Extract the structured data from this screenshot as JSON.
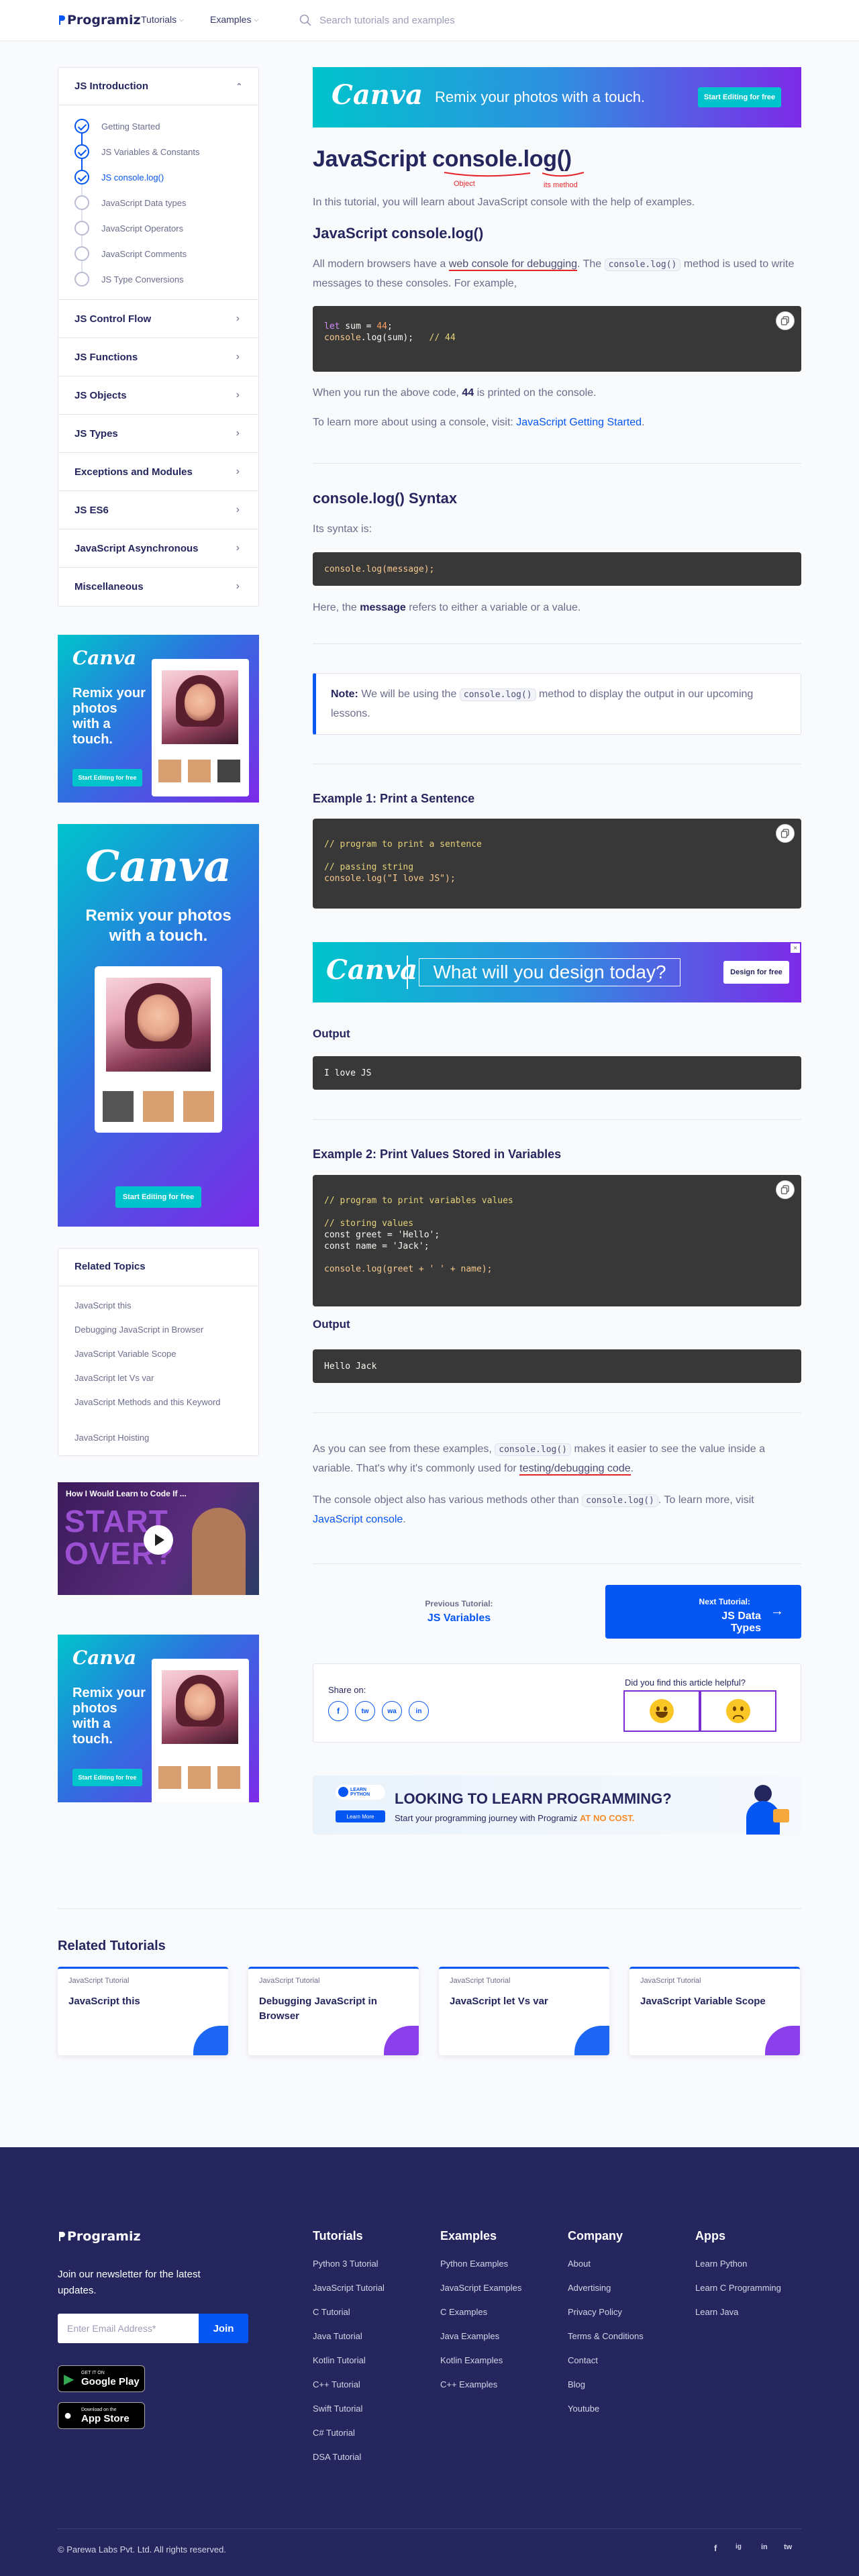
{
  "header": {
    "logo": "Programiz",
    "nav": [
      {
        "label": "Tutorials"
      },
      {
        "label": "Examples"
      }
    ],
    "search_placeholder": "Search tutorials and examples"
  },
  "sidebar": {
    "section_title": "JS Introduction",
    "lessons": [
      {
        "label": "Getting Started",
        "state": "done"
      },
      {
        "label": "JS Variables & Constants",
        "state": "done"
      },
      {
        "label": "JS console.log()",
        "state": "current"
      },
      {
        "label": "JavaScript Data types",
        "state": "todo"
      },
      {
        "label": "JavaScript Operators",
        "state": "todo"
      },
      {
        "label": "JavaScript Comments",
        "state": "todo"
      },
      {
        "label": "JS Type Conversions",
        "state": "todo"
      }
    ],
    "sections": [
      {
        "label": "JS Control Flow"
      },
      {
        "label": "JS Functions"
      },
      {
        "label": "JS Objects"
      },
      {
        "label": "JS Types"
      },
      {
        "label": "Exceptions and Modules"
      },
      {
        "label": "JS ES6"
      },
      {
        "label": "JavaScript Asynchronous"
      },
      {
        "label": "Miscellaneous"
      }
    ]
  },
  "ads": {
    "brand": "Canva",
    "top_banner": {
      "text": "Remix your photos with a touch.",
      "button": "Start Editing for free"
    },
    "side1": {
      "text": "Remix your photos with a touch.",
      "button": "Start Editing for free"
    },
    "side2": {
      "text": "Remix your photos with a touch.",
      "button": "Start Editing for free"
    },
    "side3": {
      "text": "Remix your photos with a touch.",
      "button": "Start Editing for free"
    },
    "mid_banner": {
      "text": "What will you design today?",
      "button": "Design for free"
    }
  },
  "related_topics": {
    "title": "Related Topics",
    "items": [
      {
        "label": "JavaScript this"
      },
      {
        "label": "Debugging JavaScript in Browser"
      },
      {
        "label": "JavaScript Variable Scope"
      },
      {
        "label": "JavaScript let Vs var"
      },
      {
        "label": "JavaScript Methods and this Keyword"
      },
      {
        "label": "JavaScript Hoisting"
      }
    ]
  },
  "video": {
    "caption": "How I Would Learn to Code If ...",
    "overlay": "START OVER?"
  },
  "article": {
    "title": "JavaScript console.log()",
    "annotation_object": "Object",
    "annotation_method": "its method",
    "intro": "In this tutorial, you will learn about JavaScript console with the help of examples.",
    "sec1_title": "JavaScript console.log()",
    "sec1_p1_a": "All modern browsers have a ",
    "sec1_p1_link": "web console for debugging",
    "sec1_p1_b": ". The ",
    "sec1_p1_code": "console.log()",
    "sec1_p1_c": " method is used to write messages to these consoles. For example,",
    "code1": [
      "let sum = 44;",
      "console.log(sum);   // 44"
    ],
    "p_run_a": "When you run the above code, ",
    "p_run_bold": "44",
    "p_run_b": " is printed on the console.",
    "p_learn_a": "To learn more about using a console, visit: ",
    "p_learn_link": "JavaScript Getting Started",
    "p_learn_b": ".",
    "sec2_title": "console.log() Syntax",
    "syntax_intro": "Its syntax is:",
    "syntax_code": "console.log(message);",
    "syntax_p_a": "Here, the ",
    "syntax_p_bold": "message",
    "syntax_p_b": " refers to either a variable or a value.",
    "note_label": "Note:",
    "note_a": " We will be using the ",
    "note_code": "console.log()",
    "note_b": " method to display the output in our upcoming lessons.",
    "ex1_title": "Example 1: Print a Sentence",
    "ex1_code": [
      "// program to print a sentence",
      "",
      "// passing string",
      "console.log(\"I love JS\");"
    ],
    "output_label": "Output",
    "ex1_output": "I love JS",
    "ex2_title": "Example 2: Print Values Stored in Variables",
    "ex2_code": [
      "// program to print variables values",
      "",
      "// storing values",
      "const greet = 'Hello';",
      "const name = 'Jack';",
      "",
      "console.log(greet + ' ' + name);"
    ],
    "ex2_output": "Hello Jack",
    "concl1_a": "As you can see from these examples, ",
    "concl1_code": "console.log()",
    "concl1_b": " makes it easier to see the value inside a variable. That's why it's commonly used for ",
    "concl1_u": "testing/debugging code",
    "concl1_c": ".",
    "concl2_a": "The console object also has various methods other than ",
    "concl2_code": "console.log()",
    "concl2_b": ". To learn more, visit ",
    "concl2_link": "JavaScript console",
    "concl2_c": "."
  },
  "pager": {
    "prev_label": "Previous Tutorial:",
    "prev_title": "JS Variables",
    "next_label": "Next Tutorial:",
    "next_title": "JS Data Types"
  },
  "share": {
    "label": "Share on:",
    "helpful": "Did you find this article helpful?"
  },
  "promo": {
    "headline": "LOOKING TO LEARN PROGRAMMING?",
    "sub_a": "Start your programming journey with Programiz ",
    "sub_b": "AT NO COST.",
    "badge": "LEARN PYTHON",
    "btn": "Learn More"
  },
  "related_tutorials": {
    "title": "Related Tutorials",
    "cards": [
      {
        "kind": "JavaScript Tutorial",
        "title": "JavaScript this"
      },
      {
        "kind": "JavaScript Tutorial",
        "title": "Debugging JavaScript in Browser"
      },
      {
        "kind": "JavaScript Tutorial",
        "title": "JavaScript let Vs var"
      },
      {
        "kind": "JavaScript Tutorial",
        "title": "JavaScript Variable Scope"
      }
    ]
  },
  "footer": {
    "logo": "Programiz",
    "newsletter": "Join our newsletter for the latest updates.",
    "email_placeholder": "Enter Email Address*",
    "join": "Join",
    "google_top": "GET IT ON",
    "google": "Google Play",
    "apple_top": "Download on the",
    "apple": "App Store",
    "columns": [
      {
        "title": "Tutorials",
        "links": [
          "Python 3 Tutorial",
          "JavaScript Tutorial",
          "C Tutorial",
          "Java Tutorial",
          "Kotlin Tutorial",
          "C++ Tutorial",
          "Swift Tutorial",
          "C# Tutorial",
          "DSA Tutorial"
        ]
      },
      {
        "title": "Examples",
        "links": [
          "Python Examples",
          "JavaScript Examples",
          "C Examples",
          "Java Examples",
          "Kotlin Examples",
          "C++ Examples"
        ]
      },
      {
        "title": "Company",
        "links": [
          "About",
          "Advertising",
          "Privacy Policy",
          "Terms & Conditions",
          "Contact",
          "Blog",
          "Youtube"
        ]
      },
      {
        "title": "Apps",
        "links": [
          "Learn Python",
          "Learn C Programming",
          "Learn Java"
        ]
      }
    ],
    "copyright": "© Parewa Labs Pvt. Ltd. All rights reserved.",
    "social": [
      "f",
      "ig",
      "in",
      "tw"
    ]
  },
  "colors": {
    "primary": "#0556f3",
    "navy": "#25265e",
    "footer_bg": "#25265e",
    "code_bg": "#383838",
    "canva_teal": "#00c4cc",
    "canva_purple": "#7d2ae8",
    "annotation_red": "#e3262b"
  }
}
